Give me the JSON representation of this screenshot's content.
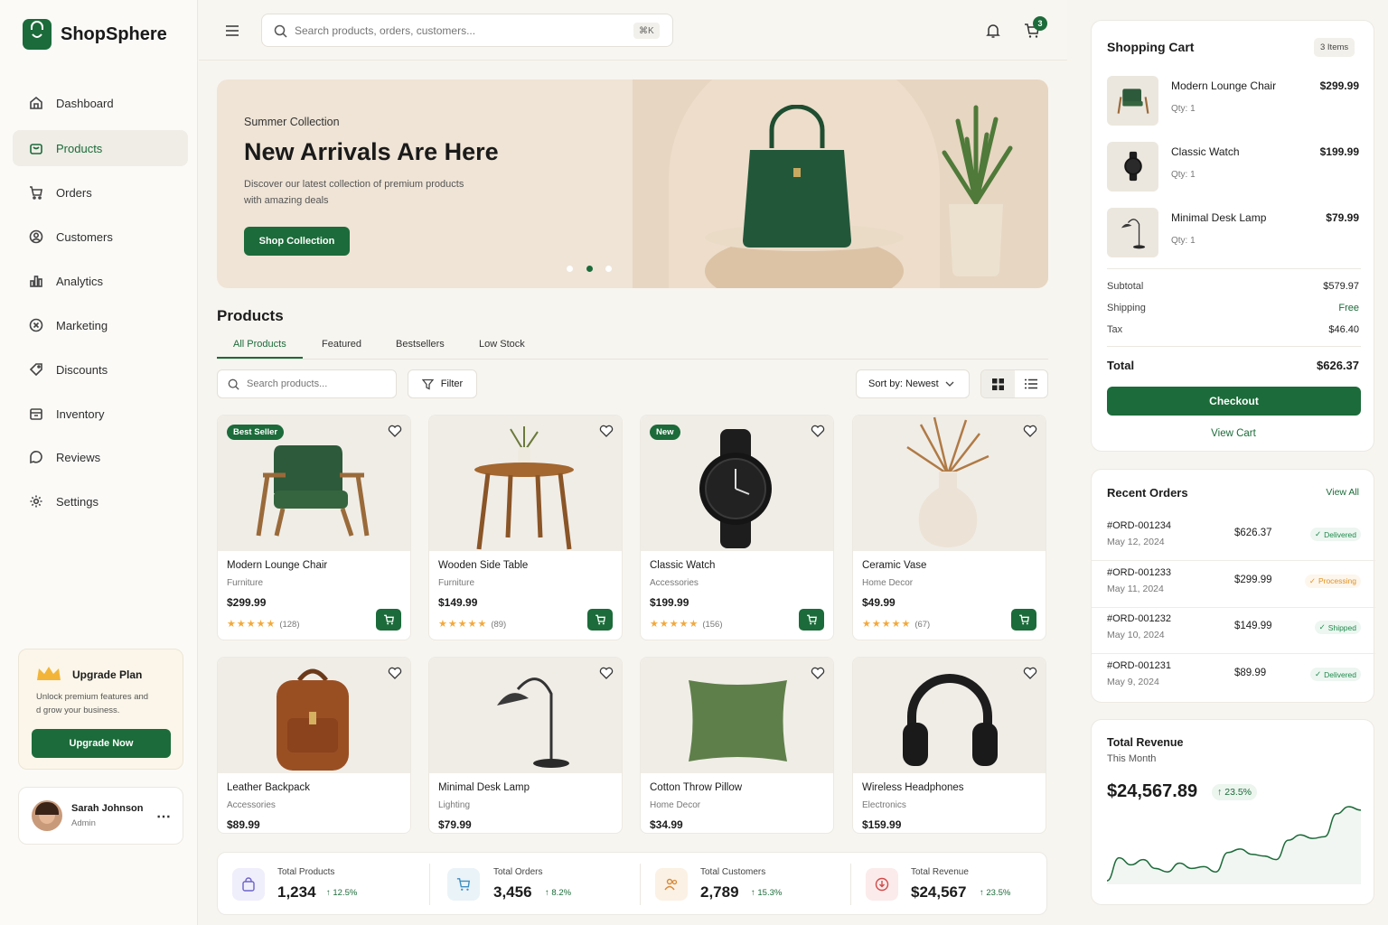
{
  "app": {
    "name": "ShopSphere"
  },
  "sidebar": {
    "items": [
      {
        "label": "Dashboard",
        "icon": "home-icon"
      },
      {
        "label": "Products",
        "icon": "bag-icon",
        "active": true
      },
      {
        "label": "Orders",
        "icon": "cart-icon"
      },
      {
        "label": "Customers",
        "icon": "user-circle-icon"
      },
      {
        "label": "Analytics",
        "icon": "bar-chart-icon"
      },
      {
        "label": "Marketing",
        "icon": "target-icon"
      },
      {
        "label": "Discounts",
        "icon": "tag-icon"
      },
      {
        "label": "Inventory",
        "icon": "box-icon"
      },
      {
        "label": "Reviews",
        "icon": "chat-icon"
      },
      {
        "label": "Settings",
        "icon": "gear-icon"
      }
    ],
    "upgrade": {
      "title": "Upgrade Plan",
      "text1": "Unlock premium features and",
      "text2": "d grow your business.",
      "button": "Upgrade Now"
    },
    "user": {
      "name": "Sarah Johnson",
      "role": "Admin"
    }
  },
  "header": {
    "search_placeholder": "Search products, orders, customers...",
    "shortcut": "⌘K",
    "cart_count": "3"
  },
  "hero": {
    "eyebrow": "Summer Collection",
    "title": "New Arrivals Are Here",
    "desc1": "Discover our latest collection of premium products",
    "desc2": "with amazing deals",
    "button": "Shop Collection"
  },
  "products": {
    "title": "Products",
    "tabs": [
      "All Products",
      "Featured",
      "Bestsellers",
      "Low Stock"
    ],
    "search_placeholder": "Search products...",
    "filter": "Filter",
    "sort": "Sort by: Newest",
    "items": [
      {
        "name": "Modern Lounge Chair",
        "category": "Furniture",
        "price": "$299.99",
        "reviews": "(128)",
        "badge": "Best Seller"
      },
      {
        "name": "Wooden Side Table",
        "category": "Furniture",
        "price": "$149.99",
        "reviews": "(89)",
        "badge": ""
      },
      {
        "name": "Classic Watch",
        "category": "Accessories",
        "price": "$199.99",
        "reviews": "(156)",
        "badge": "New"
      },
      {
        "name": "Ceramic Vase",
        "category": "Home Decor",
        "price": "$49.99",
        "reviews": "(67)",
        "badge": ""
      },
      {
        "name": "Leather Backpack",
        "category": "Accessories",
        "price": "$89.99"
      },
      {
        "name": "Minimal Desk Lamp",
        "category": "Lighting",
        "price": "$79.99"
      },
      {
        "name": "Cotton Throw Pillow",
        "category": "Home Decor",
        "price": "$34.99"
      },
      {
        "name": "Wireless Headphones",
        "category": "Electronics",
        "price": "$159.99"
      }
    ]
  },
  "stats": [
    {
      "label": "Total Products",
      "value": "1,234",
      "change": "12.5%"
    },
    {
      "label": "Total Orders",
      "value": "3,456",
      "change": "8.2%"
    },
    {
      "label": "Total Customers",
      "value": "2,789",
      "change": "15.3%"
    },
    {
      "label": "Total Revenue",
      "value": "$24,567",
      "change": "23.5%"
    }
  ],
  "cart": {
    "title": "Shopping Cart",
    "count": "3 Items",
    "items": [
      {
        "name": "Modern Lounge Chair",
        "qty": "Qty: 1",
        "price": "$299.99"
      },
      {
        "name": "Classic Watch",
        "qty": "Qty: 1",
        "price": "$199.99"
      },
      {
        "name": "Minimal Desk Lamp",
        "qty": "Qty: 1",
        "price": "$79.99"
      }
    ],
    "subtotal_label": "Subtotal",
    "subtotal": "$579.97",
    "shipping_label": "Shipping",
    "shipping": "Free",
    "tax_label": "Tax",
    "tax": "$46.40",
    "total_label": "Total",
    "total": "$626.37",
    "checkout": "Checkout",
    "view_cart": "View Cart"
  },
  "orders": {
    "title": "Recent Orders",
    "view_all": "View All",
    "items": [
      {
        "id": "#ORD-001234",
        "date": "May 12, 2024",
        "amount": "$626.37",
        "status": "Delivered",
        "color": "#1c8a4a"
      },
      {
        "id": "#ORD-001233",
        "date": "May 11, 2024",
        "amount": "$299.99",
        "status": "Processing",
        "color": "#e0901f"
      },
      {
        "id": "#ORD-001232",
        "date": "May 10, 2024",
        "amount": "$149.99",
        "status": "Shipped",
        "color": "#1c8a4a"
      },
      {
        "id": "#ORD-001231",
        "date": "May 9, 2024",
        "amount": "$89.99",
        "status": "Delivered",
        "color": "#1c8a4a"
      }
    ]
  },
  "revenue": {
    "title": "Total Revenue",
    "period": "This Month",
    "value": "$24,567.89",
    "change": "23.5%",
    "trend": [
      20,
      46,
      38,
      44,
      34,
      30,
      40,
      34,
      36,
      30,
      52,
      56,
      50,
      48,
      44,
      66,
      72,
      68,
      70,
      96,
      104,
      100
    ]
  },
  "colors": {
    "accent": "#1c6b3a",
    "star": "#f2a93b",
    "warning": "#e0901f"
  }
}
